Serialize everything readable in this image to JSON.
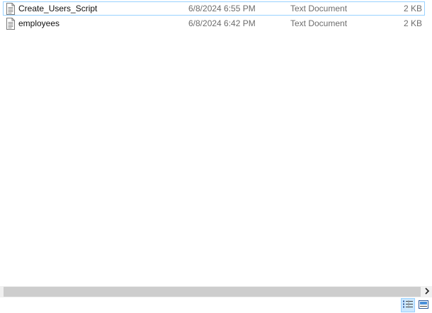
{
  "files": [
    {
      "name": "Create_Users_Script",
      "date_modified": "6/8/2024 6:55 PM",
      "type": "Text Document",
      "size": "2 KB",
      "selected": true,
      "icon": "text-document-icon"
    },
    {
      "name": "employees",
      "date_modified": "6/8/2024 6:42 PM",
      "type": "Text Document",
      "size": "2 KB",
      "selected": false,
      "icon": "text-document-icon"
    }
  ],
  "view_modes": {
    "details": "details-view-icon",
    "large_icons": "large-icons-view-icon",
    "active": "details"
  },
  "colors": {
    "selection_border": "#99d1ff",
    "active_view_bg": "#cce8ff",
    "secondary_text": "#6d6d6d"
  }
}
